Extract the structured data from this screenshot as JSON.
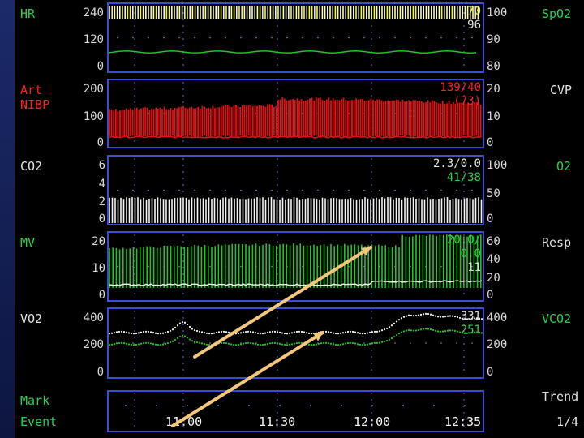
{
  "colors": {
    "screen_bg": "#000000",
    "frame": "#3a4fd0",
    "label_green": "#2bd04a",
    "label_red": "#ff2020",
    "label_white": "#e0e0e0",
    "trace_yellow": "#f0f060",
    "trace_green": "#22c322",
    "trace_red": "#e01414",
    "trace_white": "#f4f4f4",
    "arrow": "#f5c77a"
  },
  "panels": [
    {
      "left_label": [
        "HR"
      ],
      "left_label_color": "green",
      "right_label": "SpO2",
      "right_label_color": "green",
      "left_ticks": [
        "240",
        "120",
        "0"
      ],
      "right_ticks": [
        "100",
        "90",
        "80"
      ],
      "readouts": [
        {
          "text": "70",
          "color": "yellow"
        },
        {
          "text": "96",
          "color": "white"
        }
      ]
    },
    {
      "left_label": [
        "Art",
        "NIBP"
      ],
      "left_label_color": "red",
      "right_label": "CVP",
      "right_label_color": "white",
      "left_ticks": [
        "200",
        "100",
        "0"
      ],
      "right_ticks": [
        "20",
        "10",
        "0"
      ],
      "readouts": [
        {
          "text": "139/40",
          "color": "red"
        },
        {
          "text": "(73)",
          "color": "red"
        }
      ]
    },
    {
      "left_label": [
        "CO2"
      ],
      "left_label_color": "white",
      "right_label": "O2",
      "right_label_color": "green",
      "left_ticks": [
        "6",
        "4",
        "2",
        "0"
      ],
      "right_ticks": [
        "100",
        "50",
        "0"
      ],
      "readouts": [
        {
          "text": "2.3/0.0",
          "color": "white"
        },
        {
          "text": "41/38",
          "color": "green"
        }
      ]
    },
    {
      "left_label": [
        "MV"
      ],
      "left_label_color": "green",
      "right_label": "Resp",
      "right_label_color": "white",
      "left_ticks": [
        "20",
        "10",
        "0"
      ],
      "right_ticks": [
        "60",
        "40",
        "20",
        "0"
      ],
      "readouts": [
        {
          "text": "20.0/",
          "color": "green"
        },
        {
          "text": "0.0",
          "color": "green"
        },
        {
          "text": "11",
          "color": "white"
        }
      ]
    },
    {
      "left_label": [
        "VO2"
      ],
      "left_label_color": "white",
      "right_label": "VCO2",
      "right_label_color": "green",
      "left_ticks": [
        "400",
        "200",
        "0"
      ],
      "right_ticks": [
        "400",
        "200",
        "0"
      ],
      "readouts": [
        {
          "text": "331",
          "color": "white"
        },
        {
          "text": "251",
          "color": "green"
        }
      ]
    }
  ],
  "bottom": {
    "mark_label": "Mark",
    "event_label": "Event",
    "trend_label": "Trend",
    "page_label": "1/4",
    "time_labels": [
      "11:00",
      "11:30",
      "12:00",
      "12:35"
    ]
  }
}
